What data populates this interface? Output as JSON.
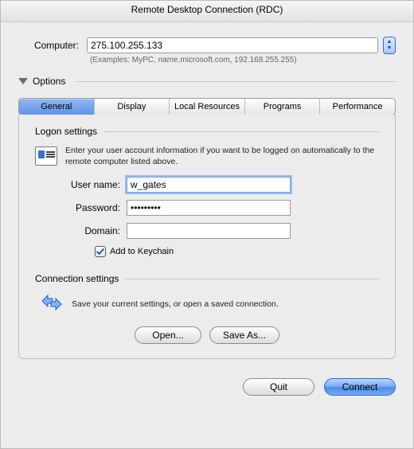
{
  "title": "Remote Desktop Connection (RDC)",
  "computer": {
    "label": "Computer:",
    "value": "275.100.255.133",
    "examples": "(Examples: MyPC, name.microsoft.com, 192.168.255.255)"
  },
  "options_label": "Options",
  "tabs": {
    "general": "General",
    "display": "Display",
    "local_resources": "Local Resources",
    "programs": "Programs",
    "performance": "Performance"
  },
  "logon": {
    "header": "Logon settings",
    "help": "Enter your user account information if you want to be logged on automatically to the remote computer listed above.",
    "username_label": "User name:",
    "username_value": "w_gates",
    "password_label": "Password:",
    "password_value": "•••••••••",
    "domain_label": "Domain:",
    "domain_value": "",
    "keychain_label": "Add to Keychain",
    "keychain_checked": true
  },
  "connection": {
    "header": "Connection settings",
    "help": "Save your current settings, or open a saved connection.",
    "open_label": "Open...",
    "saveas_label": "Save As..."
  },
  "footer": {
    "quit": "Quit",
    "connect": "Connect"
  }
}
